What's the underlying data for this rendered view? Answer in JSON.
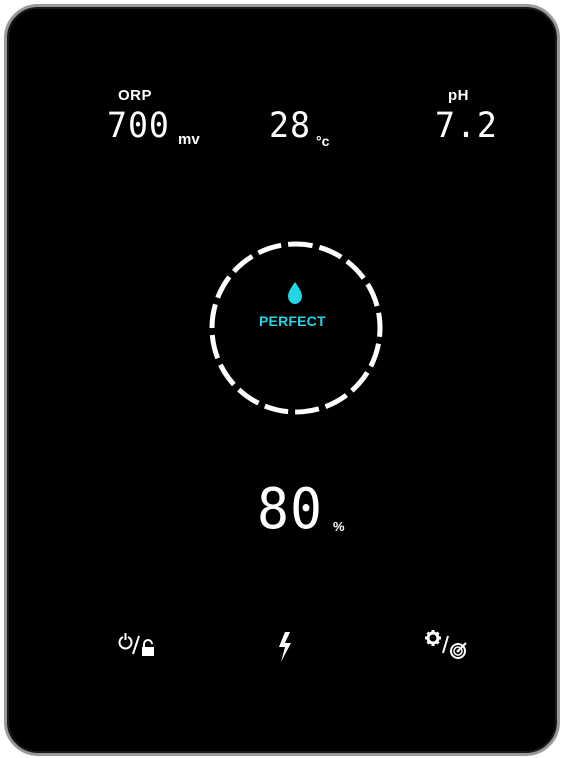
{
  "orp": {
    "label": "ORP",
    "value": "700",
    "unit": "mv"
  },
  "temperature": {
    "value": "28",
    "unit": "°c"
  },
  "ph": {
    "label": "pH",
    "value": "7.2"
  },
  "status": {
    "text": "PERFECT",
    "icon": "water-drop-icon",
    "color": "#23d6e4"
  },
  "level": {
    "value": "80",
    "unit": "%"
  },
  "controls": {
    "power_lock_icon": "power-lock-icon",
    "boost_icon": "lightning-icon",
    "settings_target_icon": "gear-target-icon"
  },
  "colors": {
    "background": "#000000",
    "text": "#ffffff",
    "accent": "#23d6e4"
  }
}
